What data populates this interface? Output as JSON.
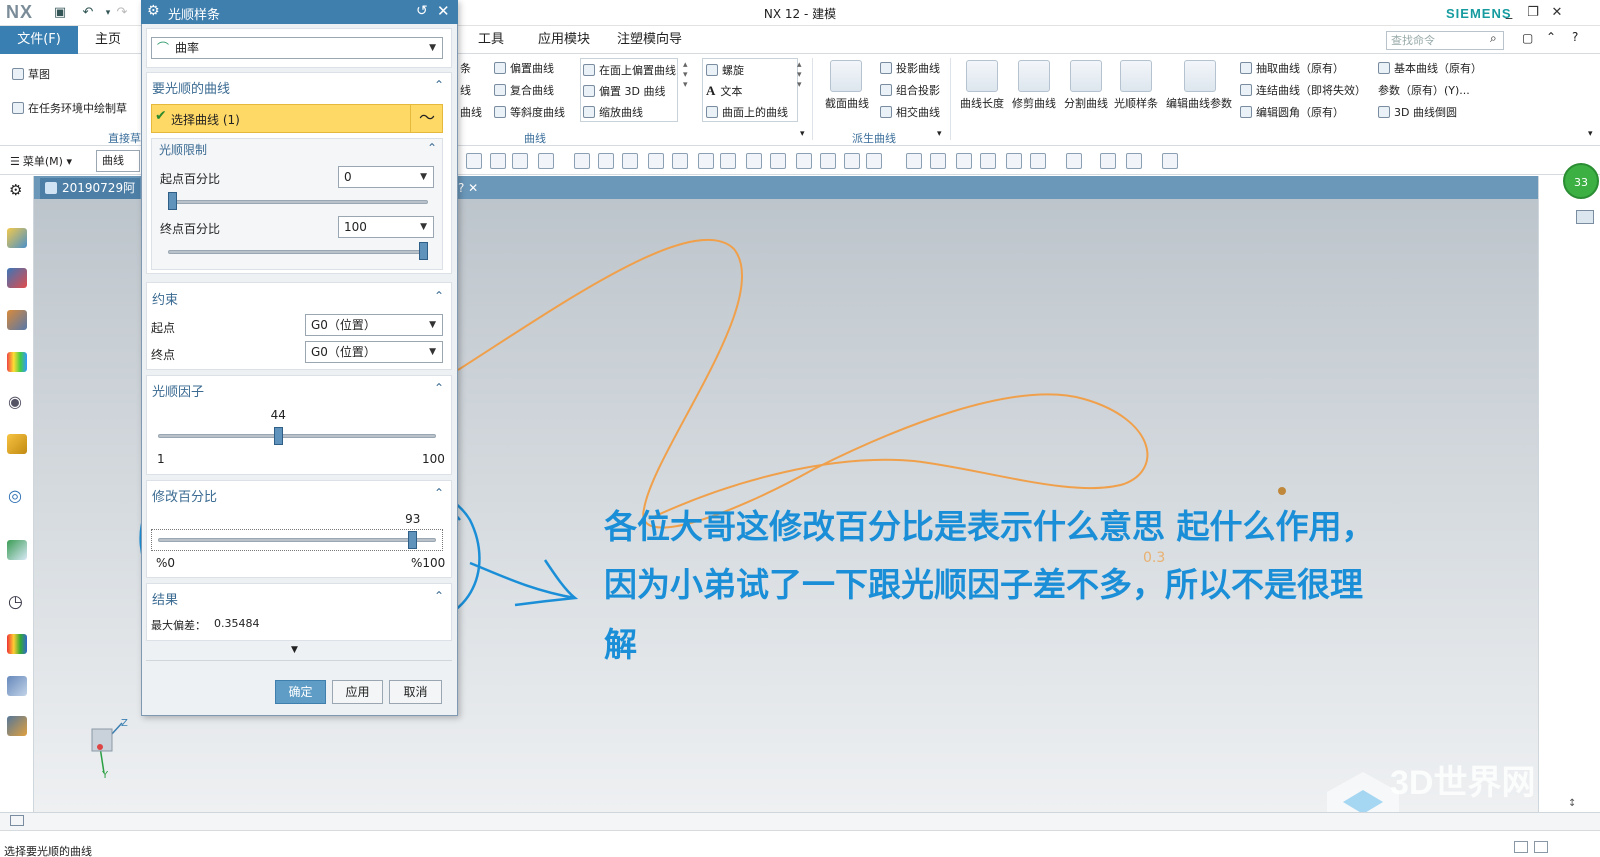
{
  "app": {
    "logo": "NX",
    "title": "NX 12 - 建模",
    "brand": "SIEMENS",
    "window_buttons": [
      "_",
      "❐",
      "✕"
    ],
    "quick_access": [
      "save-icon",
      "undo-icon",
      "redo-icon"
    ]
  },
  "menu": {
    "file": "文件(F)",
    "tabs": [
      "主页",
      "工具",
      "应用模块",
      "注塑模向导"
    ],
    "search_placeholder": "查找命令"
  },
  "ribbon": {
    "sketch": {
      "items": [
        "草图",
        "在任务环境中绘制草"
      ],
      "group": "直接草"
    },
    "curve_left": [
      "条",
      "线",
      "曲线"
    ],
    "curve_col1": [
      "偏置曲线",
      "复合曲线",
      "等斜度曲线"
    ],
    "curve_col2": [
      "在面上偏置曲线",
      "偏置 3D 曲线",
      "缩放曲线"
    ],
    "curve_col3": [
      "螺旋",
      "文本",
      "曲面上的曲线"
    ],
    "curve_group": "曲线",
    "derived_big": "截面曲线",
    "derived_col": [
      "投影曲线",
      "组合投影",
      "相交曲线"
    ],
    "derived_group": "派生曲线",
    "edit_big": [
      "曲线长度",
      "修剪曲线",
      "分割曲线",
      "光顺样条",
      "编辑曲线参数"
    ],
    "edit_col1": [
      "抽取曲线（原有）",
      "连结曲线（即将失效）",
      "编辑圆角（原有）"
    ],
    "edit_col2": [
      "基本曲线（原有）",
      "参数（原有）(Y)...",
      "3D 曲线倒圆"
    ]
  },
  "toolbar": {
    "menu_label": "菜单(M)",
    "filter_value": "曲线"
  },
  "doc": {
    "tab_label": "20190729阿迪",
    "badge": "33"
  },
  "dialog": {
    "title": "光顺样条",
    "type_value": "曲率",
    "curve_section": {
      "title": "要光顺的曲线",
      "select_label": "选择曲线 (1)"
    },
    "limit_section": {
      "title": "光顺限制",
      "start_label": "起点百分比",
      "start_value": "0",
      "start_fraction": 0,
      "end_label": "终点百分比",
      "end_value": "100",
      "end_fraction": 1
    },
    "constraint_section": {
      "title": "约束",
      "start_label": "起点",
      "start_value": "G0（位置）",
      "end_label": "终点",
      "end_value": "G0（位置）"
    },
    "factor_section": {
      "title": "光顺因子",
      "value": "44",
      "fraction": 0.43,
      "min": "1",
      "max": "100"
    },
    "modify_section": {
      "title": "修改百分比",
      "value": "93",
      "fraction": 0.93,
      "min": "%0",
      "max": "%100"
    },
    "result_section": {
      "title": "结果",
      "deviation_label": "最大偏差：",
      "deviation_value": "0.35484"
    },
    "buttons": {
      "ok": "确定",
      "apply": "应用",
      "cancel": "取消"
    }
  },
  "annotation": {
    "lines": [
      "各位大哥这修改百分比是表示什么意思 起什么作用，",
      "因为小弟试了一下跟光顺因子差不多，所以不是很理",
      "解"
    ],
    "canvas_label": "0.3"
  },
  "status": {
    "message": "选择要光顺的曲线"
  },
  "watermark": "3D世界网",
  "colors": {
    "accent": "#3f7fae",
    "curve": "#f0a04b",
    "highlight": "#ffd966",
    "annotation": "#1a8fd8"
  }
}
